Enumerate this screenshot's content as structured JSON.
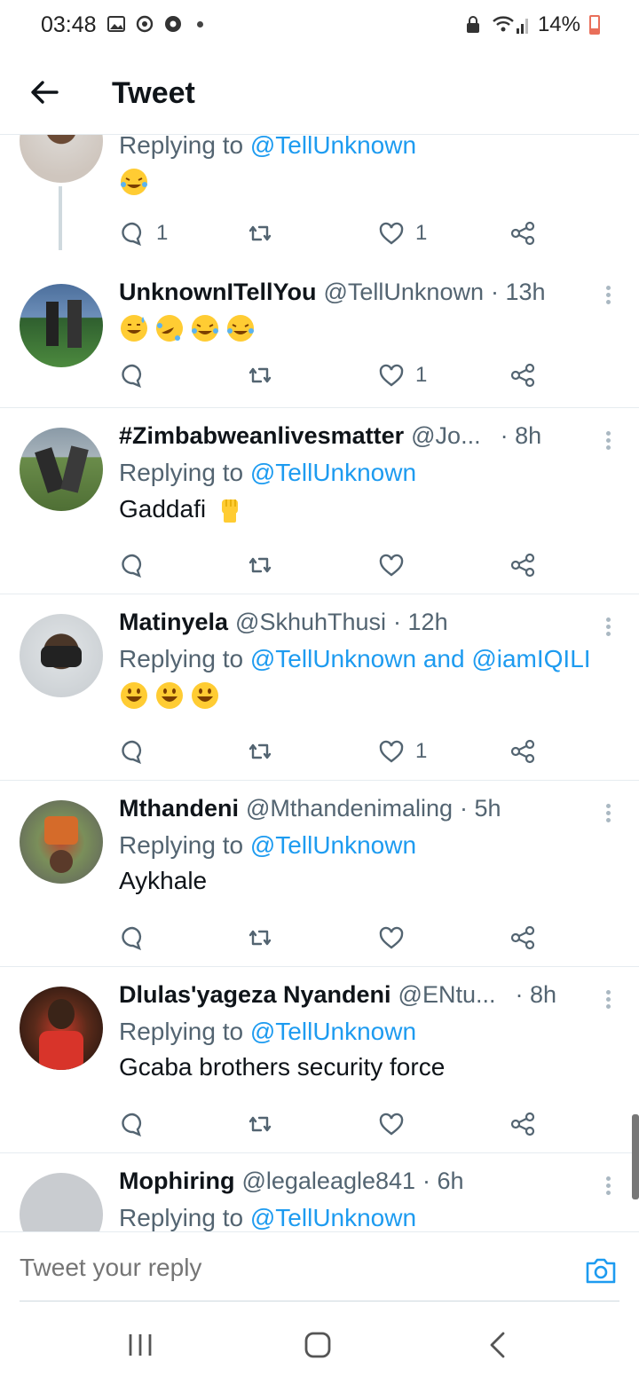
{
  "status_bar": {
    "time": "03:48",
    "battery": "14%"
  },
  "header": {
    "title": "Tweet"
  },
  "tweets": [
    {
      "reply_prefix": "Replying to",
      "reply_to": "@TellUnknown",
      "reply_count": "1",
      "like_count": "1"
    },
    {
      "name": "UnknownITellYou",
      "handle": "@TellUnknown",
      "time": "· 13h",
      "reply_count": "",
      "like_count": "1"
    },
    {
      "name": "#Zimbabweanlivesmatter",
      "handle": "@Jo...",
      "time": "· 8h",
      "reply_prefix": "Replying to",
      "reply_to": "@TellUnknown",
      "text": "Gaddafi",
      "like_count": ""
    },
    {
      "name": "Matinyela",
      "handle": "@SkhuhThusi",
      "time": "· 12h",
      "reply_prefix": "Replying to",
      "reply_to": "@TellUnknown and @iamIQILI",
      "like_count": "1"
    },
    {
      "name": "Mthandeni",
      "handle": "@Mthandenimaling",
      "time": "· 5h",
      "reply_prefix": "Replying to",
      "reply_to": "@TellUnknown",
      "text": "Aykhale",
      "like_count": ""
    },
    {
      "name": "Dlulas'yageza Nyandeni",
      "handle": "@ENtu...",
      "time": "· 8h",
      "reply_prefix": "Replying to",
      "reply_to": "@TellUnknown",
      "text": "Gcaba brothers security force",
      "like_count": ""
    },
    {
      "name": "Mophiring",
      "handle": "@legaleagle841",
      "time": "· 6h",
      "reply_prefix": "Replying to",
      "reply_to": "@TellUnknown"
    }
  ],
  "reply_bar": {
    "placeholder": "Tweet your reply"
  },
  "colors": {
    "accent": "#1d9bf0",
    "muted": "#536471",
    "divider": "#e6ecf0",
    "emoji": "#ffcc33"
  }
}
